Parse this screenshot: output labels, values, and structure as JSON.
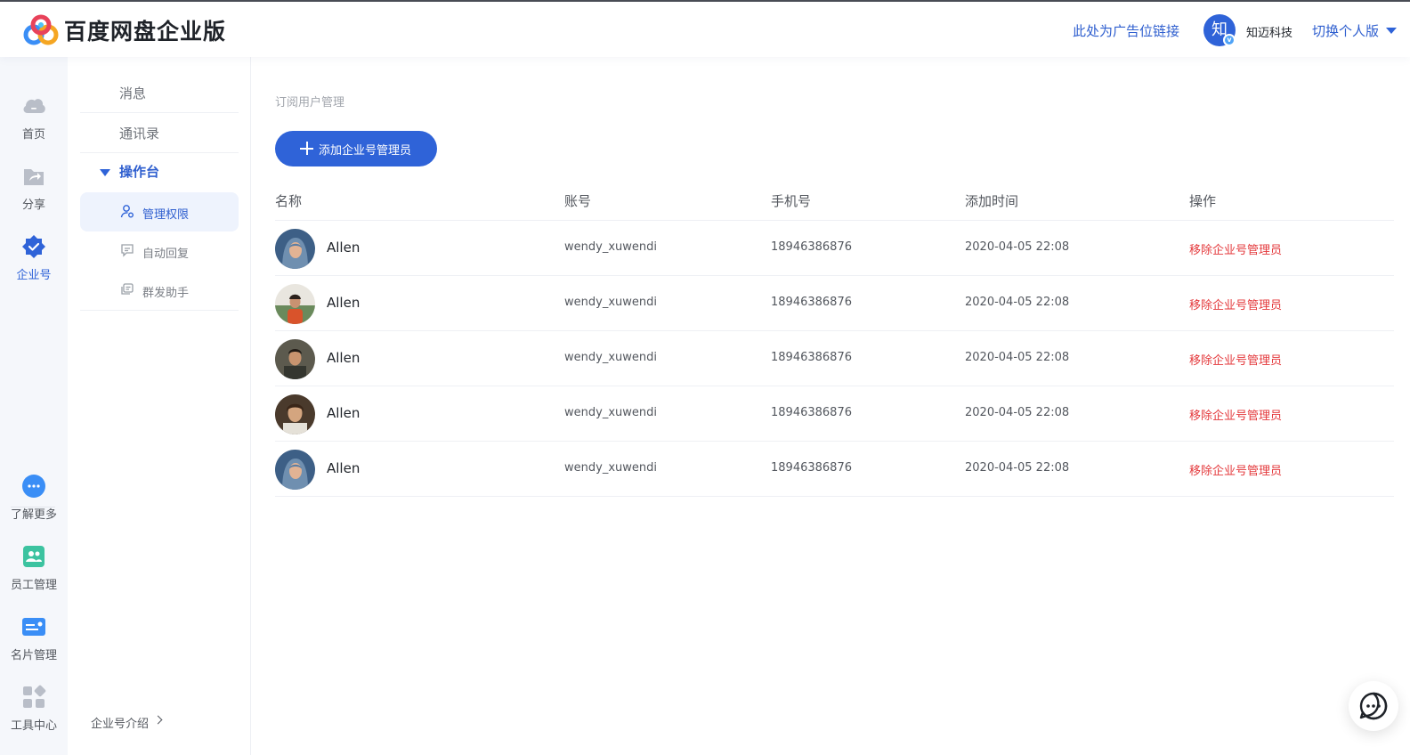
{
  "header": {
    "brand": "百度网盘企业版",
    "ad_link": "此处为广告位链接",
    "org_avatar_char": "知",
    "org_name": "知迈科技",
    "switch_label": "切换个人版"
  },
  "rail": {
    "items": [
      {
        "label": "首页",
        "icon": "cloud-icon"
      },
      {
        "label": "分享",
        "icon": "share-folder-icon"
      },
      {
        "label": "企业号",
        "icon": "enterprise-badge-icon"
      },
      {
        "label": "了解更多",
        "icon": "more-dots-icon"
      },
      {
        "label": "员工管理",
        "icon": "staff-icon"
      },
      {
        "label": "名片管理",
        "icon": "card-icon"
      },
      {
        "label": "工具中心",
        "icon": "tools-icon"
      }
    ]
  },
  "sidebar": {
    "messages": "消息",
    "contacts": "通讯录",
    "console": "操作台",
    "sub_items": [
      "管理权限",
      "自动回复",
      "群发助手"
    ],
    "intro": "企业号介绍"
  },
  "main": {
    "breadcrumb": "订阅用户管理",
    "add_button": "添加企业号管理员",
    "columns": [
      "名称",
      "账号",
      "手机号",
      "添加时间",
      "操作"
    ],
    "rows": [
      {
        "name": "Allen",
        "account": "wendy_xuwendi",
        "phone": "18946386876",
        "time": "2020-04-05 22:08",
        "action": "移除企业号管理员"
      },
      {
        "name": "Allen",
        "account": "wendy_xuwendi",
        "phone": "18946386876",
        "time": "2020-04-05 22:08",
        "action": "移除企业号管理员"
      },
      {
        "name": "Allen",
        "account": "wendy_xuwendi",
        "phone": "18946386876",
        "time": "2020-04-05 22:08",
        "action": "移除企业号管理员"
      },
      {
        "name": "Allen",
        "account": "wendy_xuwendi",
        "phone": "18946386876",
        "time": "2020-04-05 22:08",
        "action": "移除企业号管理员"
      },
      {
        "name": "Allen",
        "account": "wendy_xuwendi",
        "phone": "18946386876",
        "time": "2020-04-05 22:08",
        "action": "移除企业号管理员"
      }
    ]
  },
  "colors": {
    "accent": "#2f63d8",
    "danger": "#e4393c"
  }
}
